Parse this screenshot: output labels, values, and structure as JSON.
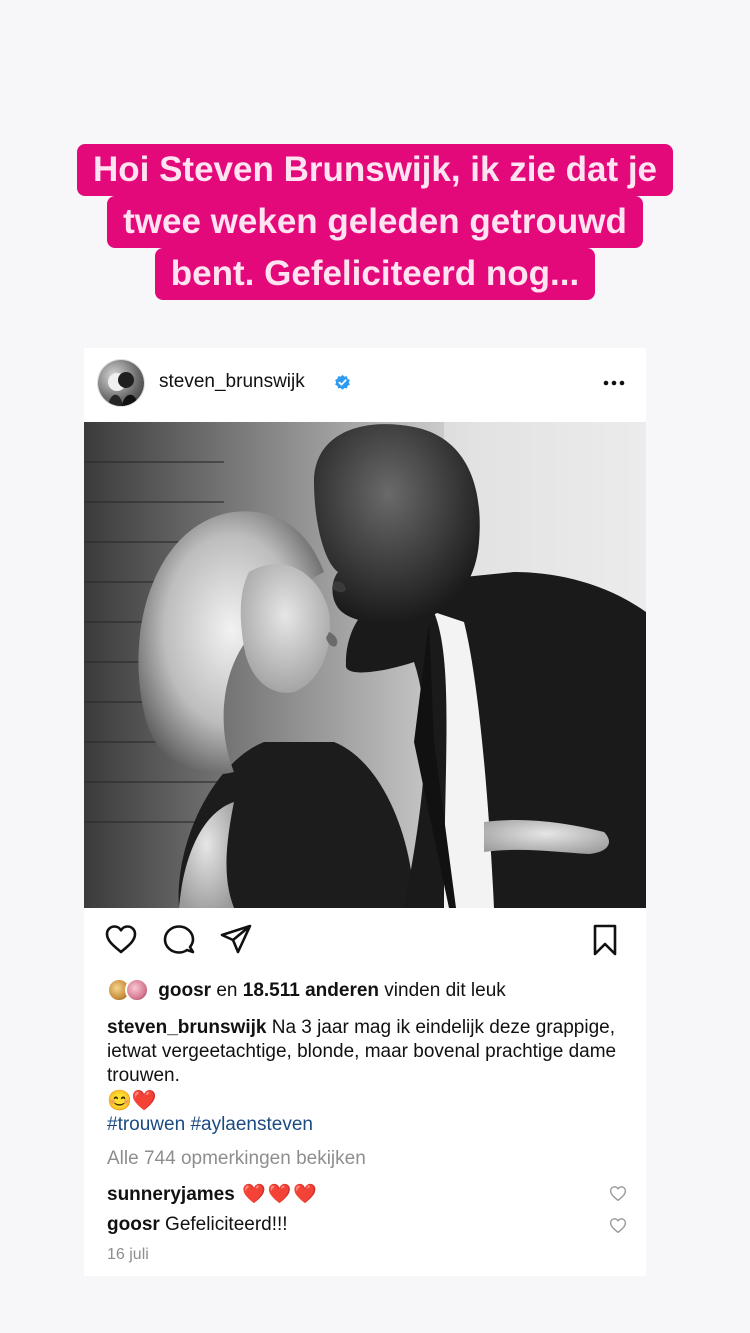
{
  "story": {
    "caption_lines": [
      "Hoi Steven Brunswijk, ik zie dat je",
      "twee weken geleden getrouwd",
      "bent. Gefeliciteerd nog..."
    ],
    "highlight_color": "#e4097b"
  },
  "post": {
    "username": "steven_brunswijk",
    "verified_icon": "verified-badge-icon",
    "more_icon": "more-options-icon",
    "photo_alt": "Zwart-wit foto van een kussend stel",
    "actions": [
      "heart-icon",
      "comment-icon",
      "share-icon",
      "bookmark-icon"
    ],
    "likes": {
      "liker": "goosr",
      "middle": " en ",
      "count_text": "18.511 anderen",
      "suffix": " vinden dit leuk"
    },
    "caption": {
      "author": "steven_brunswijk",
      "text": " Na 3 jaar mag ik eindelijk deze grappige, ietwat vergeetachtige, blonde, maar bovenal prachtige dame trouwen.",
      "emojis": "😊❤️",
      "hashtags": "#trouwen #aylaensteven"
    },
    "view_all_comments": "Alle 744 opmerkingen bekijken",
    "comments": [
      {
        "user": "sunneryjames",
        "text": " ❤️❤️❤️"
      },
      {
        "user": "goosr",
        "text": " Gefeliciteerd!!!"
      }
    ],
    "date": "16 juli"
  }
}
